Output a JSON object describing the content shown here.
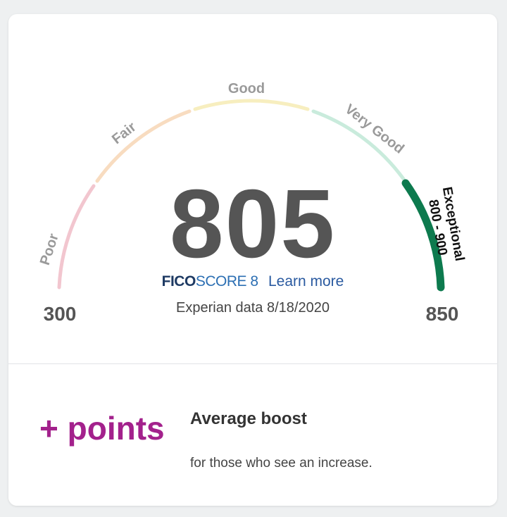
{
  "gauge": {
    "score": "805",
    "min_label": "300",
    "max_label": "850",
    "bands": [
      {
        "label": "Poor",
        "color": "#f2c6cf"
      },
      {
        "label": "Fair",
        "color": "#f8dcc0"
      },
      {
        "label": "Good",
        "color": "#f7eebf"
      },
      {
        "label": "Very Good",
        "color": "#c9ebdc"
      },
      {
        "label": "Exceptional",
        "range": "800 - 900",
        "color": "#0d7a4e"
      }
    ],
    "band_label_color": "#9a9a9a"
  },
  "fico": {
    "brand": "FICO",
    "product": "SCORE 8",
    "learn_more": "Learn more"
  },
  "data_source": "Experian data 8/18/2020",
  "boost": {
    "points_label": "+ points",
    "title": "Average boost",
    "description": "for those who see an increase.",
    "accent_color": "#a3218c"
  }
}
